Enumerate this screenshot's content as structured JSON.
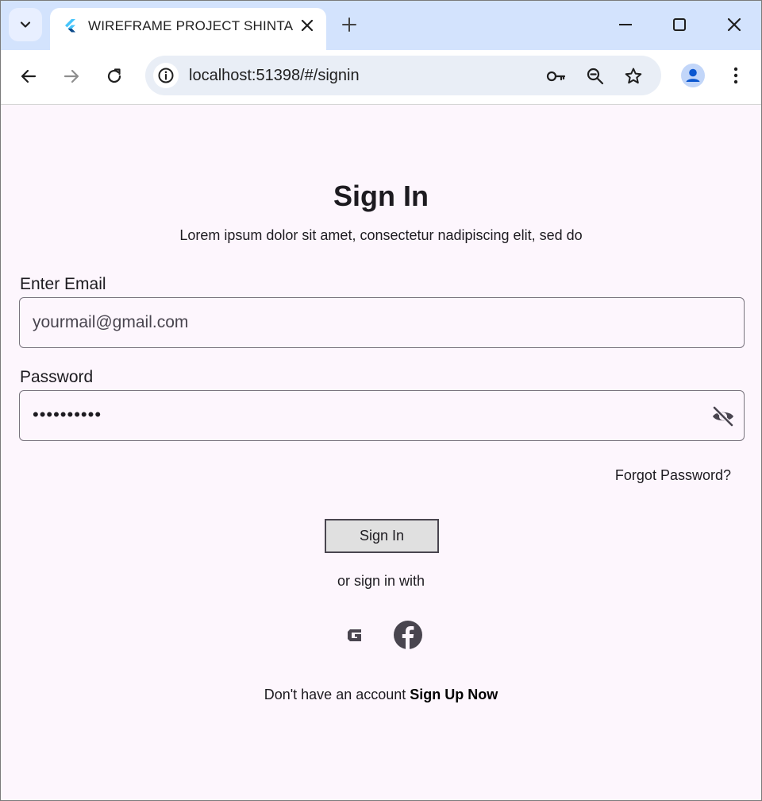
{
  "browser": {
    "tab_title": "WIREFRAME PROJECT SHINTA",
    "url": "localhost:51398/#/signin"
  },
  "page": {
    "title": "Sign In",
    "subtitle": "Lorem ipsum dolor sit amet, consectetur nadipiscing elit, sed do",
    "email_label": "Enter Email",
    "email_placeholder": "yourmail@gmail.com",
    "password_label": "Password",
    "password_value": "••••••••••",
    "forgot_password": "Forgot Password?",
    "signin_button": "Sign In",
    "or_sign_in_with": "or sign in with",
    "no_account_text": "Don't have an account",
    "signup_link": "Sign Up Now"
  },
  "icons": {
    "google": "google-icon",
    "facebook": "facebook-icon",
    "visibility_off": "visibility-off-icon"
  },
  "colors": {
    "page_background": "#fdf6fd",
    "tabstrip": "#d3e3fd",
    "button_background": "#e0e0e0",
    "text": "#1d1b20"
  }
}
